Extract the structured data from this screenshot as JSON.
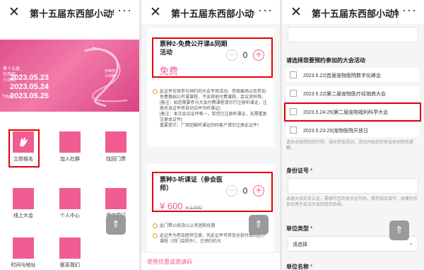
{
  "title": "第十五届东西部小动物",
  "panel1": {
    "banner": {
      "small_lines": [
        "第十五届",
        "东西部",
        "小动物"
      ],
      "dates": [
        "2023.05.23",
        "2023.05.24",
        "2023.05.25"
      ],
      "time_label": "TIME",
      "brand_lines": [
        "东西部",
        "小动物"
      ]
    },
    "grid": [
      {
        "label": "立即报名",
        "highlight": true
      },
      {
        "label": "加入社群"
      },
      {
        "label": "找回门票"
      },
      {
        "label": "线上大会"
      },
      {
        "label": "个人中心"
      },
      {
        "label": "酒店预订"
      },
      {
        "label": "时间与地址"
      },
      {
        "label": "联系我们"
      }
    ]
  },
  "panel2": {
    "ticket2": {
      "name": "票种2-免费公开课&同期活动",
      "price": "免费",
      "qty": "0",
      "notice": "此证件仅供参与预约的大会专场活动、参观展场以及参加免费基础公开课课程，不含其他付费课程、会议资料等。[备注：如您需要参与大会付费课程请另行注册听课证，注册后该证件将自动合并为听课证]",
      "notice2": "[备注：本次会议证件唯一，若您已注册听课证，无需重复注册本证件]",
      "notice3": "重要提示：厂商团报听课证的码客户请勿注册此证件！"
    },
    "ticket3": {
      "name": "票种3-听课证（参会医师）",
      "price": "¥ 600",
      "original_price": "¥ 1,000",
      "qty": "0",
      "notice": "此门票10张及以上有团购优惠",
      "notice2": "此证件为参会医师注册，凭此证件可参加全部付费的医疗课程（闭门会除外），已预约的大"
    },
    "bottom_link": "使用优惠或邀请码"
  },
  "panel3": {
    "activity_label": "请选择您要预约参加的大会活动",
    "options": [
      "2023.5.22|首届宠物医院数字化峰会",
      "2023.5.22|第二届宠物医疗经销商大会",
      "2023.5.24-25|第二届宠物福利科学大会",
      "2023.5.23-25|宠物医院开放日"
    ],
    "option_hint": "请务必按照您的行程，准时参加活动，活动开始前您将会收到短信提醒。",
    "id_label": "身份证号",
    "id_hint": "本届大会实名认证，需填写您的身份证号码，需您如实填写，收集的信息仅用于此次大会的签到系统。",
    "unit_type_label": "单位类型",
    "unit_type_value": "请选择",
    "unit_name_label": "单位名称",
    "required_mark": "*"
  }
}
